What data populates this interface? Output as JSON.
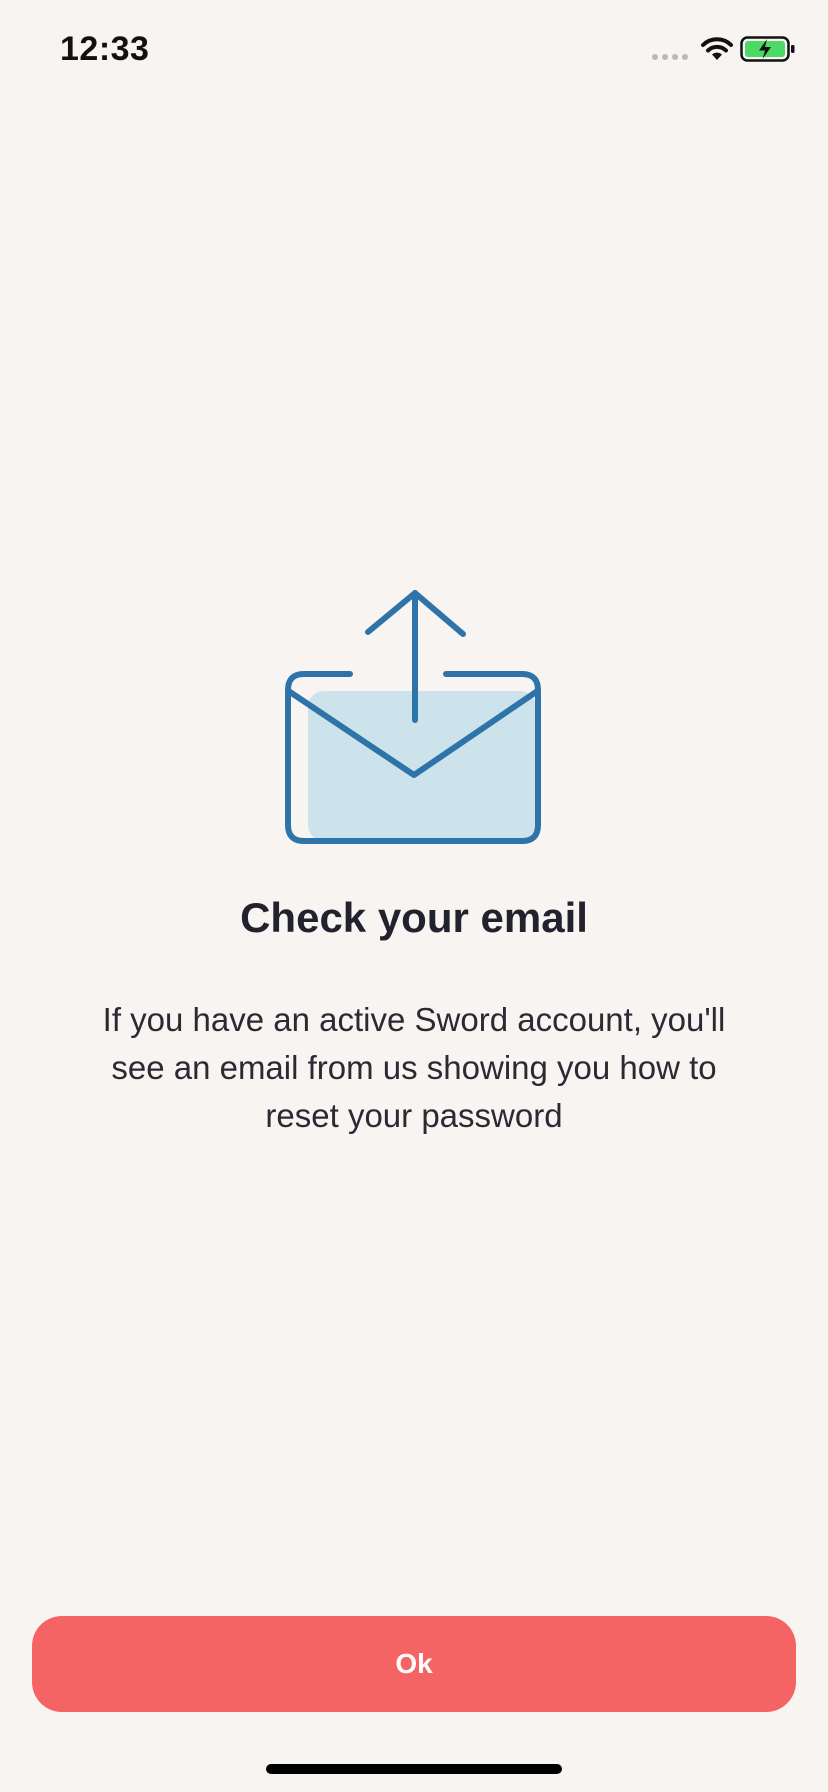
{
  "status_bar": {
    "time": "12:33"
  },
  "icons": {
    "hero": "envelope-upload-icon",
    "wifi": "wifi-icon",
    "battery": "battery-charging-icon",
    "signal": "cellular-signal-icon"
  },
  "colors": {
    "background": "#f7f4f2",
    "accent": "#f46464",
    "icon_stroke": "#2e74a8",
    "icon_fill": "#cce3ec",
    "battery_green": "#4cd964"
  },
  "content": {
    "title": "Check your email",
    "message": "If you have an active Sword account, you'll see an email from us showing you how to reset your password"
  },
  "actions": {
    "ok_label": "Ok"
  }
}
